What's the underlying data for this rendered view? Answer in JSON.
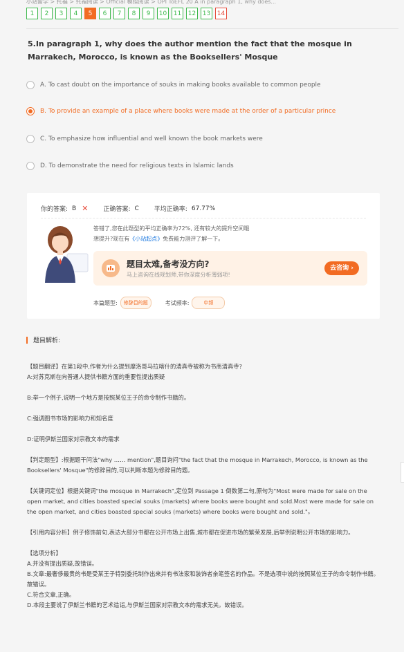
{
  "breadcrumb": "小站留学 > 托福 > 托福阅读 > Official 模拟阅读 > OPI ToEFL 20 A in paragraph 1, why does...",
  "question_nav": [
    "1",
    "2",
    "3",
    "4",
    "5",
    "6",
    "7",
    "8",
    "9",
    "10",
    "11",
    "12",
    "13",
    "14"
  ],
  "question": "5.In paragraph 1, why does the author mention the fact that the mosque in Marrakech, Morocco, is known as the Booksellers' Mosque",
  "options": [
    "A. To cast doubt on the importance of souks in making books available to common people",
    "B. To provide an example of a place where books were made at the order of a particular prince",
    "C. To emphasize how influential and well known the book markets were",
    "D. To demonstrate the need for religious texts in Islamic lands"
  ],
  "result": {
    "your_answer_label": "你的答案:",
    "your_answer": "B",
    "correct_answer_label": "正确答案:",
    "correct_answer": "C",
    "avg_label": "平均正确率:",
    "avg_value": "67.77%",
    "tip_line1": "答错了,您在此题型的平均正确率为72%, 还有较大的提升空间哦",
    "tip_line2_pre": "想提升?现在有",
    "tip_line2_link": "《小站起点》",
    "tip_line2_post": "免费能力测评了解一下。",
    "promo_title": "题目太难,备考没方向?",
    "promo_sub": "马上咨询在线规划师,带你深度分析薄弱项!",
    "promo_btn": "去咨询 ›",
    "type_label": "本篇题型:",
    "type_value": "修辞目的题",
    "freq_label": "考试频率:",
    "freq_value": "中频"
  },
  "analysis": {
    "heading": "题目解析:",
    "lines": [
      "【题目翻译】在第1段中,作者为什么提到摩洛哥马拉喀什的清真寺被称为书商清真寺?",
      "A:对苏克斯在向普通人提供书籍方面的重要性提出质疑",
      "",
      "B:举一个例子,说明一个地方是按照某位王子的命令制作书籍的。",
      "",
      "C:强调图书市场的影响力和知名度",
      "",
      "D:证明伊斯兰国家对宗教文本的需求",
      "",
      "【判定题型】:根据题干问法\"why …… mention\",题目询问\"the fact that the mosque in Marrakech, Morocco, is known as the Booksellers' Mosque\"的修辞目的,可以判断本题为修辞目的题。",
      "",
      "【关键词定位】根据关键词\"the mosque in Marrakech\",定位到 Passage 1 倒数第二句,原句为\"Most were made for sale on the open market, and cities boasted special souks (markets) where books were bought and sold.Most were made for sale on the open market, and cities boasted special souks (markets) where books were bought and sold.\"。",
      "",
      "【引用内容分析】例子修饰前句,表达大部分书都在公开市场上出售,城市都在促进市场的繁荣发展,后举例说明公开市场的影响力。",
      "",
      "【选项分析】",
      "A.并没有提出质疑,故错误。",
      "B.文章:最奢侈最贵的书是受某王子特别委托制作出来并有书法家和装饰者亲笔签名的作品。不是选项中说的按照某位王子的命令制作书籍。故错误。",
      "C.符合文章,正确。",
      "D.本段主要说了伊斯兰书籍的艺术造诣,与伊斯兰国家对宗教文本的需求无关。故错误。"
    ]
  }
}
